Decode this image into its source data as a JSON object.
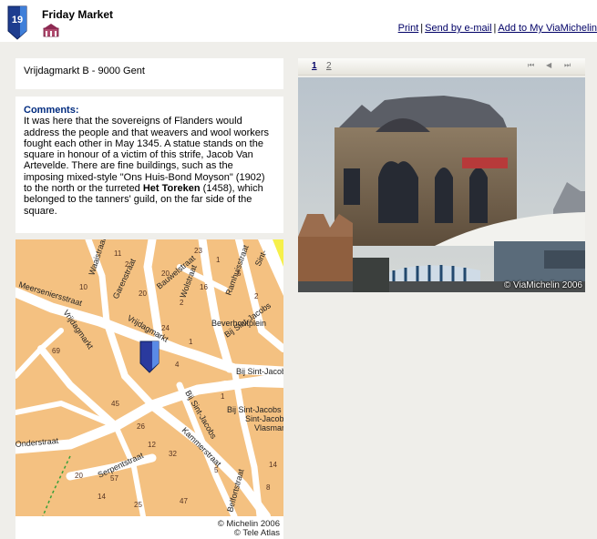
{
  "header": {
    "badge_number": "19",
    "title": "Friday Market",
    "links": {
      "print": "Print",
      "separator": "|",
      "email": "Send by e-mail",
      "add": "Add to My ViaMichelin"
    }
  },
  "address": "Vrijdagmarkt B - 9000 Gent",
  "comments": {
    "label": "Comments:",
    "text_part1": "It was here that the sovereigns of Flanders would address the people and that weavers and wool workers fought each other in May 1345. A statue stands on the square in honour of a victim of this strife, Jacob Van Artevelde. There are fine buildings, such as the imposing mixed-style \"Ons Huis-Bond Moyson\" (1902) to the north or the turreted ",
    "bold": "Het Toreken",
    "text_part2": " (1458), which belonged to the tanners' guild, on the far side of the square."
  },
  "map": {
    "street_labels": [
      "Waaistraat",
      "Garenstraat",
      "Meerseniersstraat",
      "Vrijdagmarkt",
      "Vrijdagmarkt",
      "Bauwelstraat",
      "Wolstraat",
      "Ramhuisstraat",
      "Sint-",
      "Beverhoutplein",
      "Bij Sint-Jacobs",
      "Bij Sint-Jacobs",
      "Bij Sint-Jacobs",
      "Bij Sint-Jacobs",
      "Onderstraat",
      "Serpentstraat",
      "Kammerstraat",
      "Belfortstraat",
      "Vlasmarkt",
      "Sint-Jacobs"
    ],
    "house_numbers": [
      "10",
      "11",
      "2",
      "20",
      "23",
      "1",
      "5",
      "20",
      "16",
      "2",
      "24",
      "1",
      "4",
      "69",
      "45",
      "26",
      "12",
      "32",
      "57",
      "14",
      "20",
      "25",
      "5",
      "14",
      "8",
      "1",
      "2",
      "47"
    ],
    "copyright_line1": "© Michelin 2006",
    "copyright_line2": "© Tele Atlas",
    "colors": {
      "block": "#f4c181",
      "street": "#ffffff",
      "marker": "#2a3a9e",
      "marker_side": "#5a8ae6"
    }
  },
  "photo": {
    "pages": [
      "1",
      "2"
    ],
    "nav_icons": [
      "first-icon",
      "prev-icon",
      "next-icon",
      "last-icon"
    ],
    "credit": "© ViaMichelin 2006"
  }
}
